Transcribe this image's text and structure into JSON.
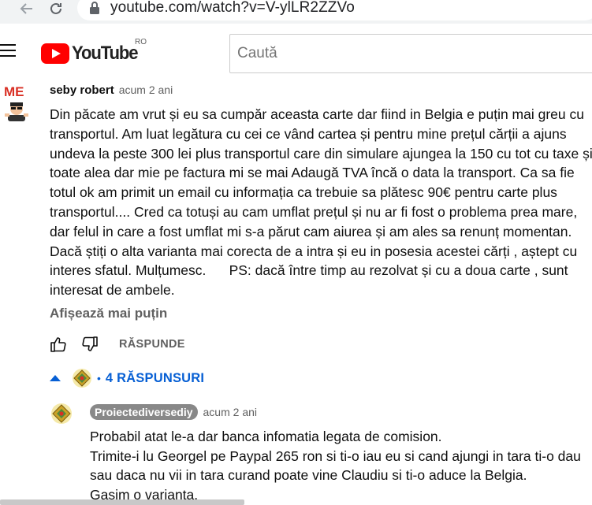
{
  "browser": {
    "url": "youtube.com/watch?v=V-ylLR2ZZVo"
  },
  "header": {
    "logo_text": "YouTube",
    "region": "RO",
    "search_placeholder": "Caută"
  },
  "comment": {
    "author": "seby robert",
    "time": "acum 2 ani",
    "avatar_label": "ME",
    "text": "Din păcate am vrut și eu sa cumpăr aceasta carte dar fiind in Belgia e puțin mai greu cu transportul. Am luat legătura cu cei ce vând cartea și pentru mine prețul cărții a ajuns undeva la peste 300 lei plus transportul care din simulare ajungea la 150 cu tot cu taxe și toate alea dar mie pe factura mi se mai Adaugă TVA încă o data la transport. Ca sa fie totul ok am primit un email cu informația ca trebuie sa plătesc 90€ pentru carte plus transportul.... Cred ca totuși au cam umflat prețul și nu ar fi fost o problema prea mare, dar felul in care a fost umflat mi s-a părut cam aiurea și am ales sa renunț momentan. Dacă știți o alta varianta mai corecta de a intra și eu in posesia acestei cărți , aștept cu interes sfatul. Mulțumesc.      PS: dacă între timp au rezolvat și cu a doua carte , sunt interesat de ambele.",
    "show_less": "Afișează mai puțin",
    "reply_label": "RĂSPUNDE",
    "replies_label": "4 RĂSPUNSURI"
  },
  "reply": {
    "author": "Proiectediversediy",
    "time": "acum 2 ani",
    "lines": [
      "Probabil atat le-a dar banca infomatia legata de comision.",
      "Trimite-i lu Georgel pe Paypal 265 ron si ti-o iau eu si cand ajungi in tara ti-o dau sau daca nu vii in tara curand poate vine Claudiu si ti-o aduce la Belgia.",
      "Gasim o varianta."
    ]
  },
  "colors": {
    "accent": "#065fd4",
    "brand": "#ff0000",
    "muted": "#606060"
  }
}
